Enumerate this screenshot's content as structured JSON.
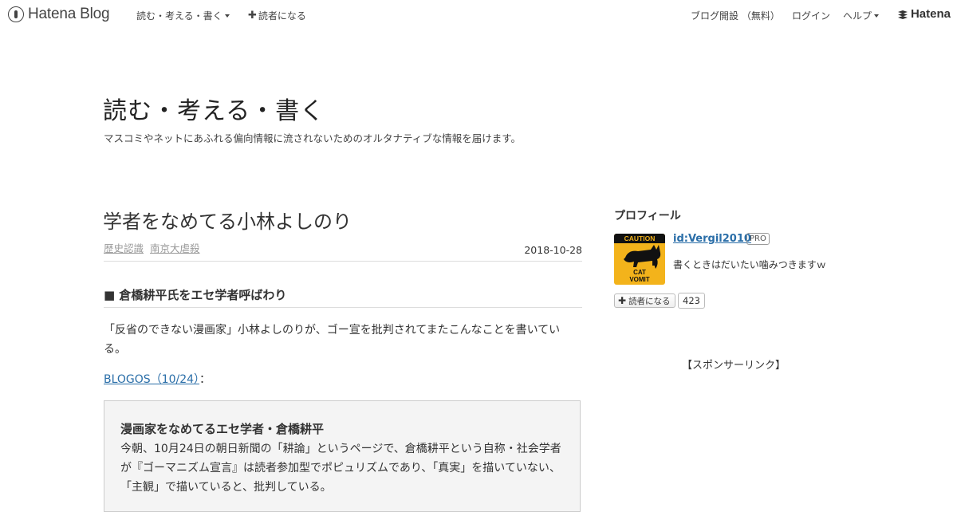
{
  "topbar": {
    "logo_text": "Hatena Blog",
    "blog_menu_label": "読む・考える・書く",
    "subscribe_label": "読者になる",
    "open_blog_label": "ブログ開設 （無料）",
    "login_label": "ログイン",
    "help_label": "ヘルプ",
    "hatena_label": "Hatena"
  },
  "blog": {
    "title": "読む・考える・書く",
    "description": "マスコミやネットにあふれる偏向情報に流されないためのオルタナティブな情報を届けます。"
  },
  "entry": {
    "title": "学者をなめてる小林よしのり",
    "categories": [
      "歴史認識",
      "南京大虐殺"
    ],
    "date": "2018-10-28",
    "section_heading": "■ 倉橋耕平氏をエセ学者呼ばわり",
    "paragraph": "「反省のできない漫画家」小林よしのりが、ゴー宣を批判されてまたこんなことを書いている。",
    "link_text": "BLOGOS（10/24）",
    "link_suffix": "：",
    "quote": {
      "title": "漫画家をなめてるエセ学者・倉橋耕平",
      "body": "今朝、10月24日の朝日新聞の「耕論」というページで、倉橋耕平という自称・社会学者が『ゴーマニズム宣言』は読者参加型でポピュリズムであり、「真実」を描いていない、「主観」で描いていると、批判している。"
    }
  },
  "sidebar": {
    "profile_heading": "プロフィール",
    "avatar": {
      "top_text": "CAUTION",
      "bottom_line1": "CAT",
      "bottom_line2": "VOMIT"
    },
    "profile_id": "id:Vergil2010",
    "pro_badge": "PRO",
    "profile_desc": "書くときはだいたい噛みつきますｗ",
    "subscribe_button": "読者になる",
    "subscriber_count": "423",
    "sponsor_text": "【スポンサーリンク】"
  },
  "colors": {
    "link": "#2a6ea8",
    "avatar_bg": "#f3b31b",
    "quote_bg": "#f4f4f4"
  }
}
